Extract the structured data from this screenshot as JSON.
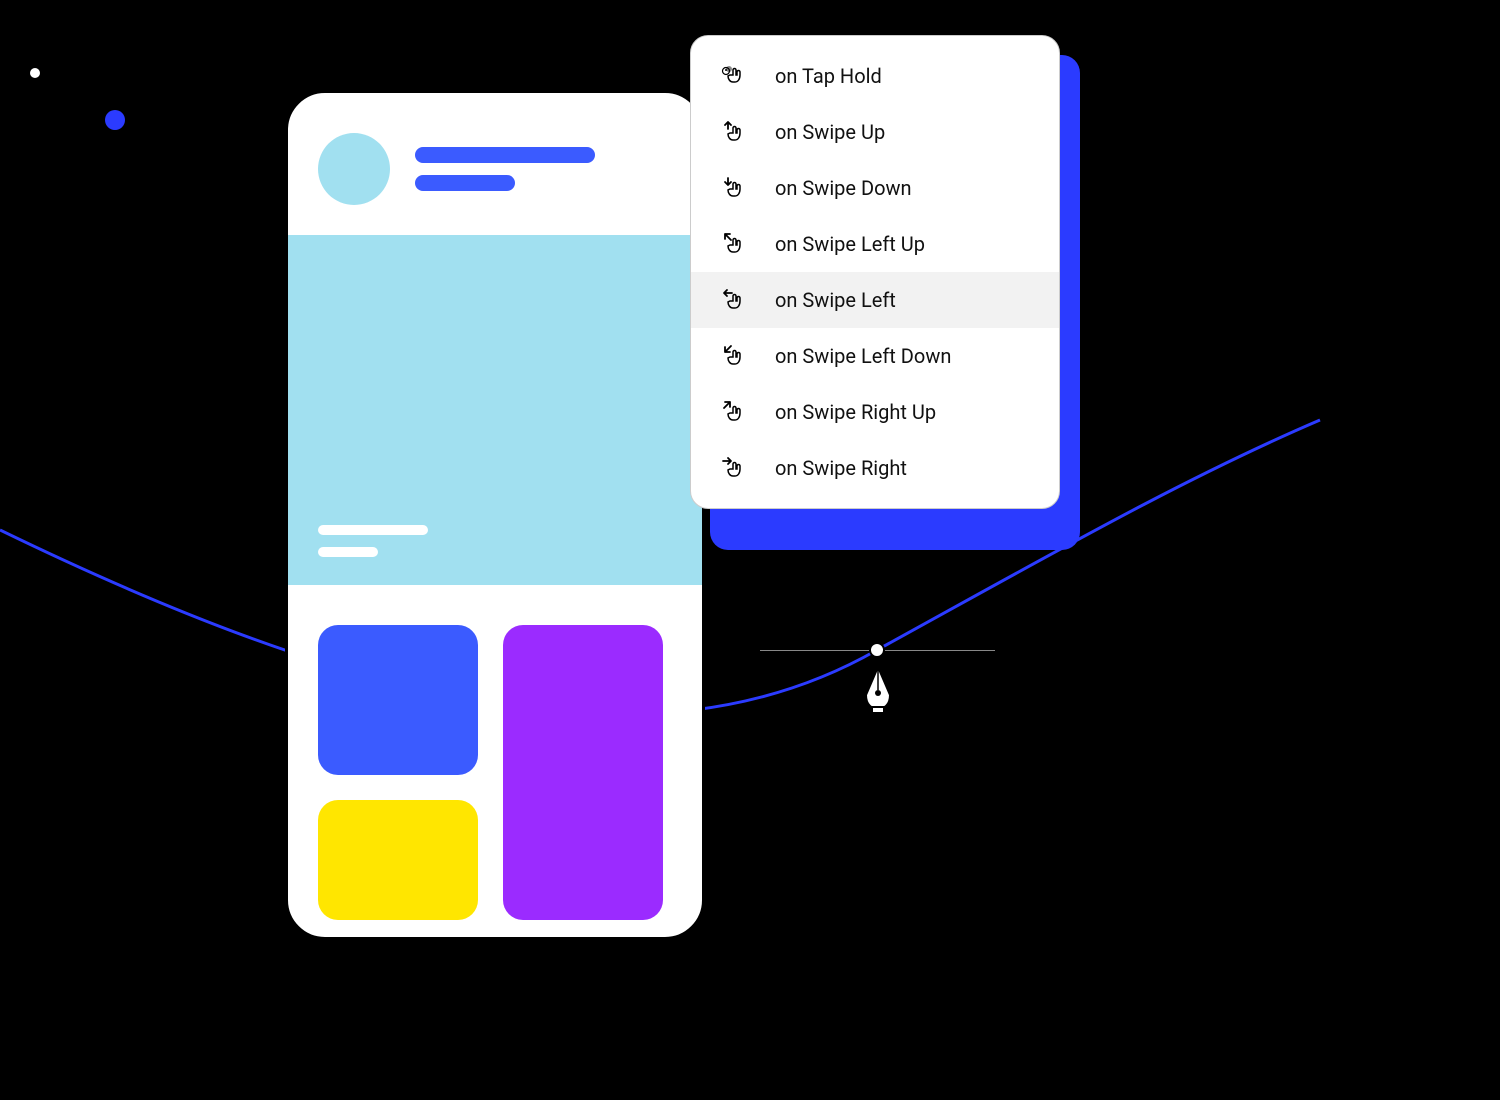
{
  "menu": {
    "items": [
      {
        "label": "on Tap Hold",
        "icon": "tap-hold-icon",
        "selected": false
      },
      {
        "label": "on Swipe Up",
        "icon": "swipe-up-icon",
        "selected": false
      },
      {
        "label": "on Swipe Down",
        "icon": "swipe-down-icon",
        "selected": false
      },
      {
        "label": "on Swipe Left Up",
        "icon": "swipe-left-up-icon",
        "selected": false
      },
      {
        "label": "on Swipe Left",
        "icon": "swipe-left-icon",
        "selected": true
      },
      {
        "label": "on Swipe Left Down",
        "icon": "swipe-left-down-icon",
        "selected": false
      },
      {
        "label": "on Swipe Right Up",
        "icon": "swipe-right-up-icon",
        "selected": false
      },
      {
        "label": "on Swipe Right",
        "icon": "swipe-right-icon",
        "selected": false
      }
    ]
  },
  "colors": {
    "accent_blue": "#3b5bff",
    "avatar_bg": "#a1e0f0",
    "card_blue": "#3b5bff",
    "card_yellow": "#ffe600",
    "card_purple": "#9b2bff"
  }
}
